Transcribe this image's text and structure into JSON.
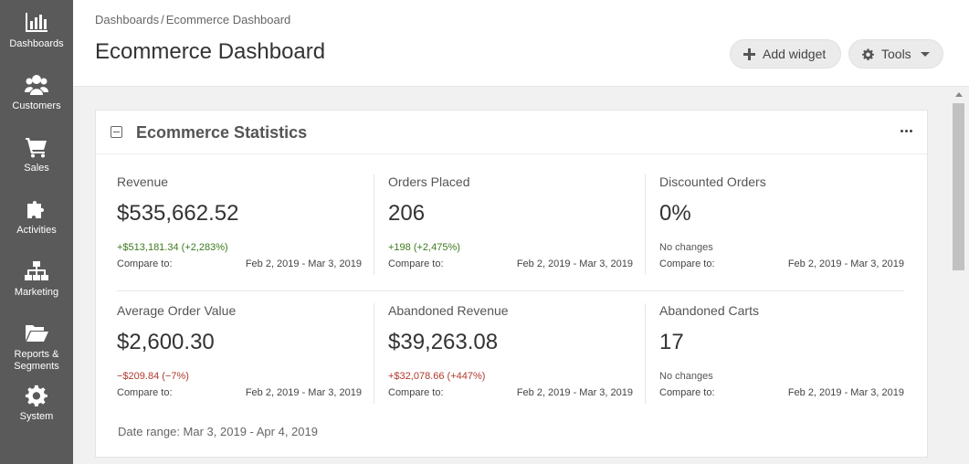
{
  "sidebar": {
    "items": [
      {
        "label": "Dashboards",
        "icon": "bar-chart-icon"
      },
      {
        "label": "Customers",
        "icon": "users-icon"
      },
      {
        "label": "Sales",
        "icon": "cart-icon"
      },
      {
        "label": "Activities",
        "icon": "puzzle-icon"
      },
      {
        "label": "Marketing",
        "icon": "sitemap-icon"
      },
      {
        "label": "Reports & Segments",
        "icon": "folder-open-icon"
      },
      {
        "label": "System",
        "icon": "gear-icon"
      }
    ]
  },
  "header": {
    "breadcrumb": [
      "Dashboards",
      "Ecommerce Dashboard"
    ],
    "breadcrumb_separator": "/",
    "title": "Ecommerce Dashboard",
    "add_widget_label": "Add widget",
    "tools_label": "Tools"
  },
  "widget": {
    "title": "Ecommerce Statistics",
    "compare_label": "Compare to:",
    "stats": [
      {
        "label": "Revenue",
        "value": "$535,662.52",
        "change": "+$513,181.34 (+2,283%)",
        "trend": "pos",
        "compare_range": "Feb 2, 2019 - Mar 3, 2019"
      },
      {
        "label": "Orders Placed",
        "value": "206",
        "change": "+198 (+2,475%)",
        "trend": "pos",
        "compare_range": "Feb 2, 2019 - Mar 3, 2019"
      },
      {
        "label": "Discounted Orders",
        "value": "0%",
        "change": "No changes",
        "trend": "none",
        "compare_range": "Feb 2, 2019 - Mar 3, 2019"
      },
      {
        "label": "Average Order Value",
        "value": "$2,600.30",
        "change": "−$209.84 (−7%)",
        "trend": "neg",
        "compare_range": "Feb 2, 2019 - Mar 3, 2019"
      },
      {
        "label": "Abandoned Revenue",
        "value": "$39,263.08",
        "change": "+$32,078.66 (+447%)",
        "trend": "neg",
        "compare_range": "Feb 2, 2019 - Mar 3, 2019"
      },
      {
        "label": "Abandoned Carts",
        "value": "17",
        "change": "No changes",
        "trend": "none",
        "compare_range": "Feb 2, 2019 - Mar 3, 2019"
      }
    ],
    "date_range": "Date range: Mar 3, 2019 - Apr 4, 2019"
  }
}
